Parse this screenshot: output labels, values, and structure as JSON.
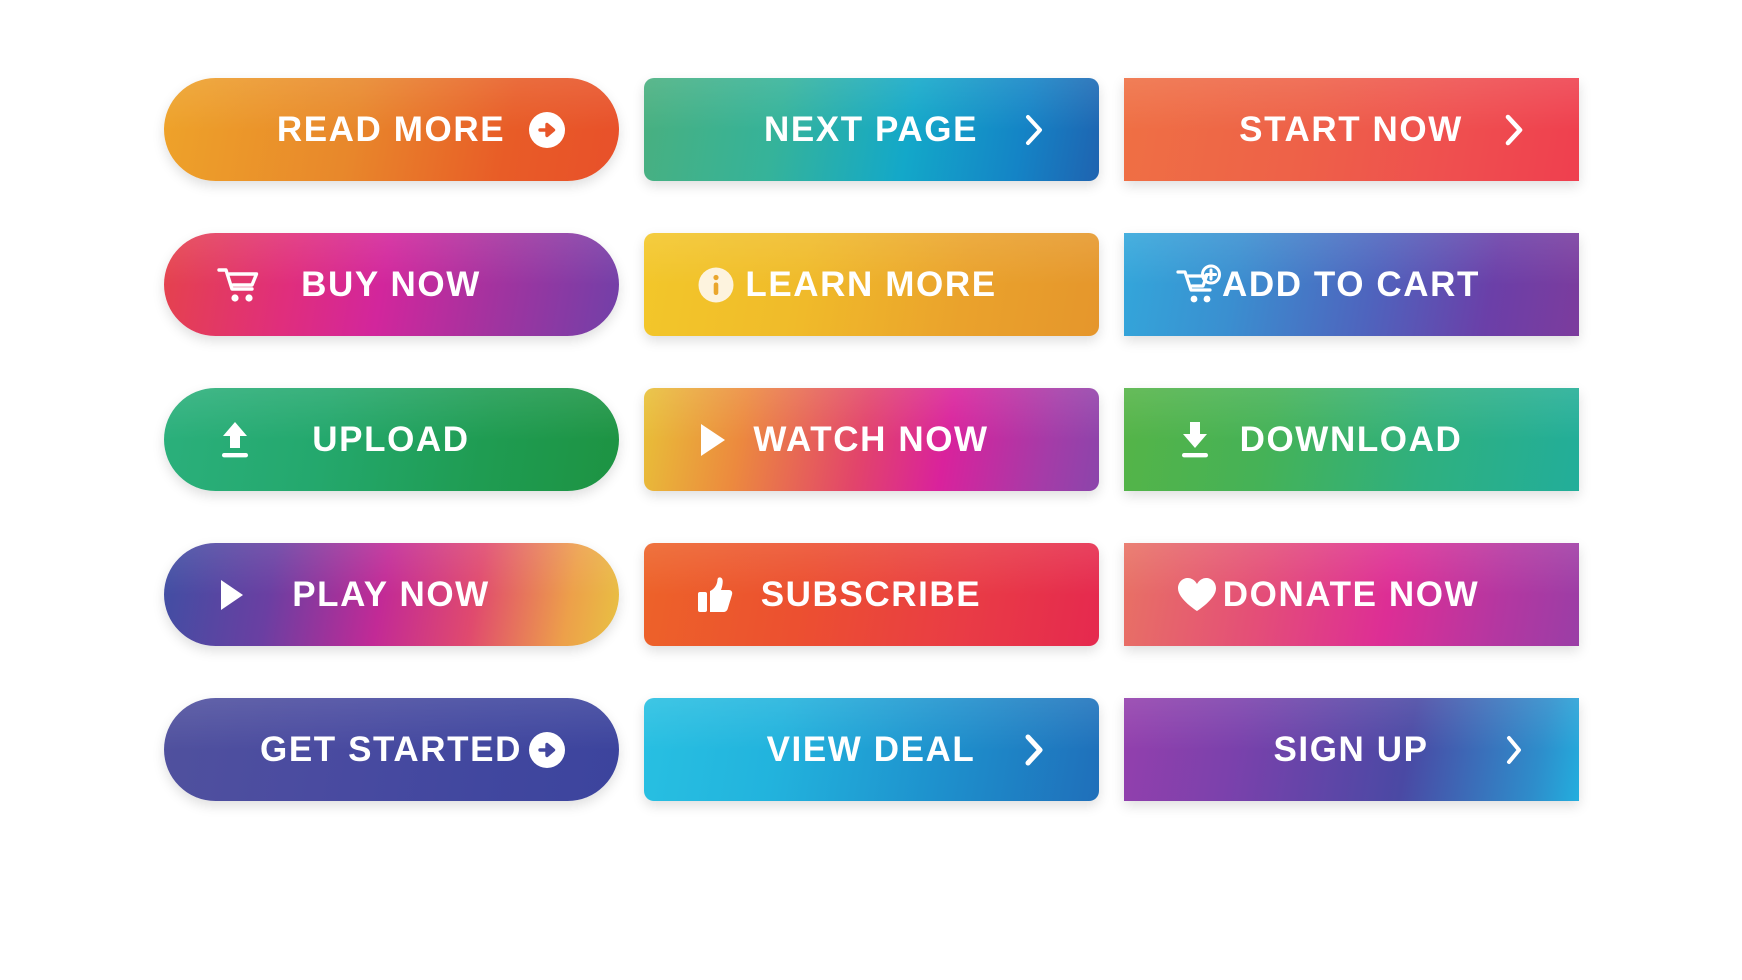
{
  "page": {
    "title": "Gradient Call-To-Action Button Set",
    "background_color": "#ffffff",
    "columns": 3,
    "rows": 5
  },
  "buttons": [
    {
      "label": "READ MORE",
      "icon": "circle-arrow-right-icon",
      "icon_position": "right",
      "shape": "pill",
      "gradient_colors": [
        "#eea32a",
        "#e8872b",
        "#e85c27",
        "#e8502a"
      ]
    },
    {
      "label": "NEXT PAGE",
      "icon": "chevron-right-icon",
      "icon_position": "right",
      "shape": "rounded",
      "gradient_colors": [
        "#49b07f",
        "#35b39a",
        "#13a8c9",
        "#1484c6",
        "#1f63b0"
      ]
    },
    {
      "label": "START NOW",
      "icon": "chevron-right-icon",
      "icon_position": "right",
      "shape": "sharp",
      "gradient_colors": [
        "#ef7044",
        "#ee6148",
        "#ef4f4f",
        "#ef3f4f"
      ]
    },
    {
      "label": "BUY NOW",
      "icon": "shopping-cart-icon",
      "icon_position": "left",
      "shape": "pill",
      "gradient_colors": [
        "#e5434b",
        "#e02e7c",
        "#d2269c",
        "#a3339f",
        "#7140a8"
      ]
    },
    {
      "label": "LEARN MORE",
      "icon": "info-circle-icon",
      "icon_position": "left",
      "shape": "rounded",
      "gradient_colors": [
        "#f3c72a",
        "#f0bb2a",
        "#eaa22c",
        "#e5962c"
      ]
    },
    {
      "label": "ADD TO CART",
      "icon": "cart-plus-icon",
      "icon_position": "left",
      "shape": "sharp",
      "gradient_colors": [
        "#33a7db",
        "#3a8fd0",
        "#4f63bd",
        "#6b3fa8",
        "#7c3c9d"
      ]
    },
    {
      "label": "UPLOAD",
      "icon": "upload-icon",
      "icon_position": "left",
      "shape": "pill",
      "gradient_colors": [
        "#2bb07c",
        "#24a86d",
        "#1f9c52",
        "#1d9342"
      ]
    },
    {
      "label": "WATCH NOW",
      "icon": "play-triangle-icon",
      "icon_position": "left",
      "shape": "rounded",
      "gradient_colors": [
        "#e8c138",
        "#ec8a3e",
        "#e2446b",
        "#d9229c",
        "#a43ca8",
        "#8b45ab"
      ]
    },
    {
      "label": "DOWNLOAD",
      "icon": "download-icon",
      "icon_position": "left",
      "shape": "sharp",
      "gradient_colors": [
        "#55b447",
        "#45b257",
        "#2fb07f",
        "#22ae9a"
      ]
    },
    {
      "label": "PLAY NOW",
      "icon": "play-triangle-icon",
      "icon_position": "left",
      "shape": "pill",
      "gradient_colors": [
        "#3f4fa3",
        "#6a3fa2",
        "#c22a96",
        "#e04a6e",
        "#eda04a",
        "#e8c242"
      ]
    },
    {
      "label": "SUBSCRIBE",
      "icon": "thumbs-up-icon",
      "icon_position": "left",
      "shape": "rounded",
      "gradient_colors": [
        "#ed6329",
        "#ec5030",
        "#e93c45",
        "#e5294f"
      ]
    },
    {
      "label": "DONATE NOW",
      "icon": "heart-icon",
      "icon_position": "left",
      "shape": "sharp",
      "gradient_colors": [
        "#e87264",
        "#e44f77",
        "#dd2e95",
        "#b437a1",
        "#9a3ea6"
      ]
    },
    {
      "label": "GET STARTED",
      "icon": "circle-arrow-right-icon",
      "icon_position": "right",
      "shape": "pill",
      "gradient_colors": [
        "#50519e",
        "#4a4ba0",
        "#41479f",
        "#3c449d"
      ]
    },
    {
      "label": "VIEW DEAL",
      "icon": "chevron-right-icon",
      "icon_position": "right",
      "shape": "rounded",
      "gradient_colors": [
        "#28c0e2",
        "#22b3dd",
        "#1e91cd",
        "#1f6fba"
      ]
    },
    {
      "label": "SIGN UP",
      "icon": "chevron-right-icon",
      "icon_position": "right",
      "shape": "sharp",
      "gradient_colors": [
        "#9440ad",
        "#7b41ac",
        "#4a49a4",
        "#2e8dcb",
        "#23aede"
      ]
    }
  ]
}
